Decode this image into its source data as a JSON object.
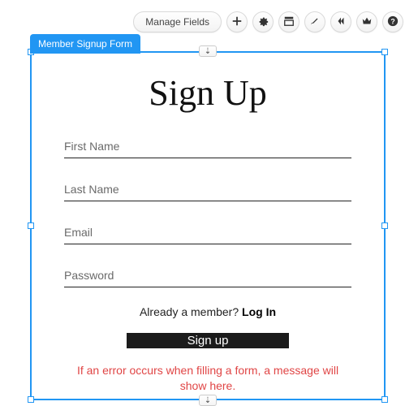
{
  "toolbar": {
    "manage_fields": "Manage Fields"
  },
  "tag": "Member Signup Form",
  "form": {
    "title": "Sign Up",
    "fields": {
      "first_name": "First Name",
      "last_name": "Last Name",
      "email": "Email",
      "password": "Password"
    },
    "login_prompt": "Already a member? ",
    "login_link": "Log In",
    "submit": "Sign up",
    "error": "If an error occurs when filling a form, a message will show here."
  }
}
